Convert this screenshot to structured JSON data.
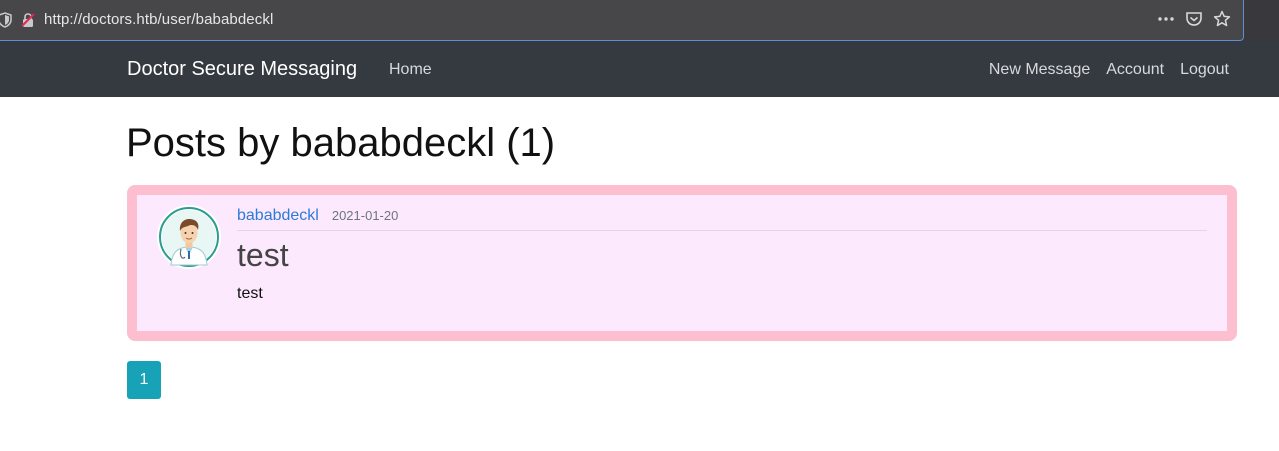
{
  "browser": {
    "url": "http://doctors.htb/user/bababdeckl",
    "icons": [
      "shield-icon",
      "insecure-lock-icon",
      "more-icon",
      "pocket-icon",
      "bookmark-star-icon"
    ]
  },
  "navbar": {
    "brand": "Doctor Secure Messaging",
    "home": "Home",
    "new_message": "New Message",
    "account": "Account",
    "logout": "Logout"
  },
  "page": {
    "title": "Posts by bababdeckl (1)"
  },
  "posts": [
    {
      "author": "bababdeckl",
      "date": "2021-01-20",
      "title": "test",
      "content": "test",
      "avatar": "doctor-avatar"
    }
  ],
  "pagination": {
    "current": "1"
  },
  "colors": {
    "navbar_bg": "#343a40",
    "card_bg": "#fde9fd",
    "card_border": "#fdbfd0",
    "link": "#2c7bd6",
    "page_button": "#17a2b8"
  }
}
